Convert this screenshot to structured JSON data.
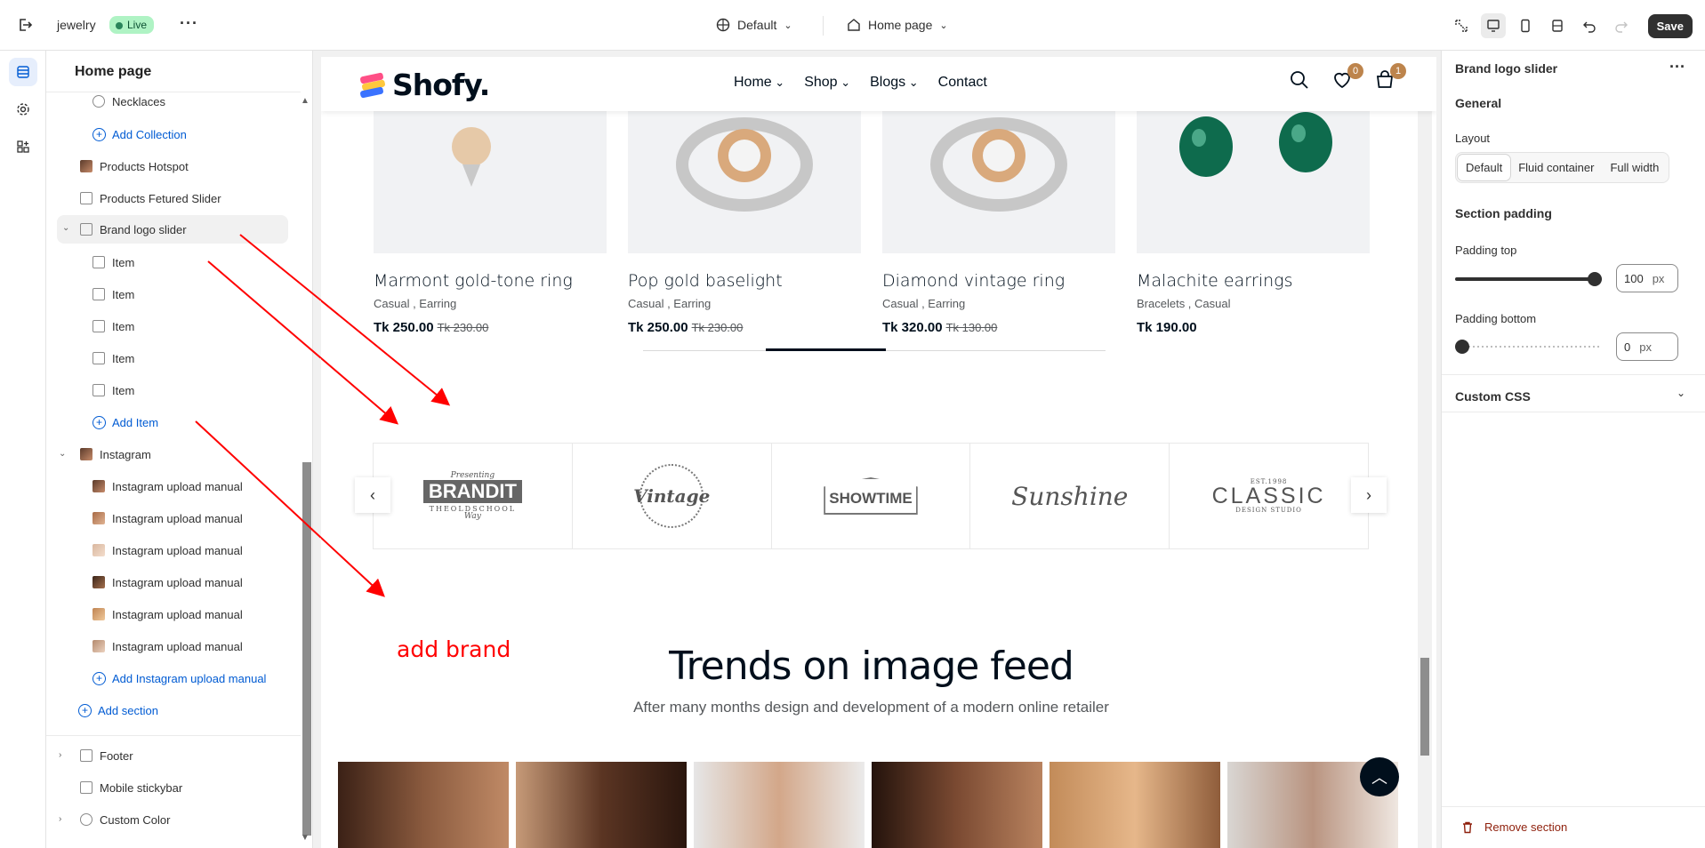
{
  "topbar": {
    "store_name": "jewelry",
    "live_label": "Live",
    "theme_label": "Default",
    "page_label": "Home page",
    "save_label": "Save"
  },
  "left_panel": {
    "title": "Home page",
    "items": [
      {
        "label": "Necklaces",
        "kind": "child",
        "icon": "collection-icon"
      },
      {
        "label": "Add Collection",
        "kind": "add"
      },
      {
        "label": "Products Hotspot",
        "kind": "section",
        "icon": "thumb"
      },
      {
        "label": "Products Fetured Slider",
        "kind": "section",
        "icon": "slider-icon"
      },
      {
        "label": "Brand logo slider",
        "kind": "section-selected",
        "icon": "brand-icon"
      },
      {
        "label": "Item",
        "kind": "child"
      },
      {
        "label": "Item",
        "kind": "child"
      },
      {
        "label": "Item",
        "kind": "child"
      },
      {
        "label": "Item",
        "kind": "child"
      },
      {
        "label": "Item",
        "kind": "child"
      },
      {
        "label": "Add Item",
        "kind": "add"
      },
      {
        "label": "Instagram",
        "kind": "section"
      },
      {
        "label": "Instagram upload manual",
        "kind": "child"
      },
      {
        "label": "Instagram upload manual",
        "kind": "child"
      },
      {
        "label": "Instagram upload manual",
        "kind": "child"
      },
      {
        "label": "Instagram upload manual",
        "kind": "child"
      },
      {
        "label": "Instagram upload manual",
        "kind": "child"
      },
      {
        "label": "Instagram upload manual",
        "kind": "child"
      },
      {
        "label": "Add Instagram upload manual",
        "kind": "add"
      },
      {
        "label": "Add section",
        "kind": "add"
      },
      {
        "label": "Footer",
        "kind": "section"
      },
      {
        "label": "Mobile stickybar",
        "kind": "section"
      },
      {
        "label": "Custom Color",
        "kind": "section"
      }
    ]
  },
  "store": {
    "logo_text": "Shofy.",
    "nav": [
      "Home",
      "Shop",
      "Blogs",
      "Contact"
    ],
    "wishlist_count": "0",
    "cart_count": "1",
    "products": [
      {
        "name": "Marmont gold-tone ring",
        "category": "Casual , Earring",
        "price": "Tk 250.00",
        "old_price": "Tk 230.00"
      },
      {
        "name": "Pop gold baselight",
        "category": "Casual , Earring",
        "price": "Tk 250.00",
        "old_price": "Tk 230.00"
      },
      {
        "name": "Diamond vintage ring",
        "category": "Casual , Earring",
        "price": "Tk 320.00",
        "old_price": "Tk 130.00"
      },
      {
        "name": "Malachite earrings",
        "category": "Bracelets , Casual",
        "price": "Tk 190.00",
        "old_price": ""
      }
    ],
    "brands": [
      "BRANDIT",
      "Vintage",
      "SHOWTIME",
      "Sunshine",
      "CLASSIC"
    ],
    "brand_small": {
      "brandit_top": "Presenting",
      "brandit_bottom": "THEOLDSCHOOL",
      "brandit_way": "Way",
      "classic_top": "EST.1998",
      "classic_bottom": "DESIGN STUDIO"
    },
    "trends_title": "Trends on image feed",
    "trends_subtitle": "After many months design and development of a modern online retailer",
    "annotation": "add brand"
  },
  "right_panel": {
    "title": "Brand logo slider",
    "general_label": "General",
    "layout_label": "Layout",
    "layout_options": [
      "Default",
      "Fluid container",
      "Full width"
    ],
    "layout_selected": "Default",
    "section_padding_label": "Section padding",
    "padding_top_label": "Padding top",
    "padding_top_value": "100",
    "padding_bottom_label": "Padding bottom",
    "padding_bottom_value": "0",
    "unit": "px",
    "custom_css_label": "Custom CSS",
    "remove_label": "Remove section"
  },
  "colors": {
    "accent": "#005bd3",
    "brand_dark": "#010f1c",
    "badge": "#bd844c",
    "annotation": "#ff0000"
  }
}
